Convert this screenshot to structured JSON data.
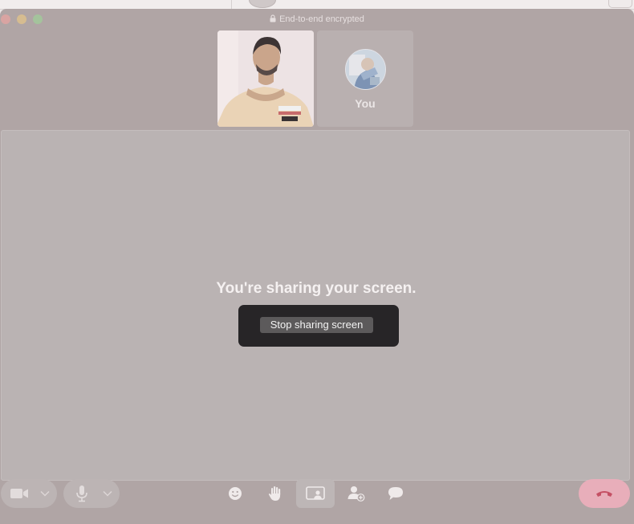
{
  "window": {
    "encryption_label": "End-to-end encrypted"
  },
  "participants": {
    "self_label": "You"
  },
  "share": {
    "title": "You're sharing your screen.",
    "stop_button": "Stop sharing screen"
  },
  "controls": {
    "items": [
      {
        "icon": "video-camera-icon"
      },
      {
        "icon": "chevron-down-icon"
      },
      {
        "icon": "microphone-icon"
      },
      {
        "icon": "chevron-down-icon"
      },
      {
        "icon": "emoji-icon"
      },
      {
        "icon": "raise-hand-icon"
      },
      {
        "icon": "screen-share-icon",
        "active": true
      },
      {
        "icon": "add-participant-icon"
      },
      {
        "icon": "chat-icon"
      },
      {
        "icon": "end-call-icon"
      }
    ]
  },
  "colors": {
    "window_bg": "#b0a5a5",
    "stage_bg": "#bab3b3",
    "panel_bg": "#272527",
    "end_call": "#e8aeba"
  }
}
